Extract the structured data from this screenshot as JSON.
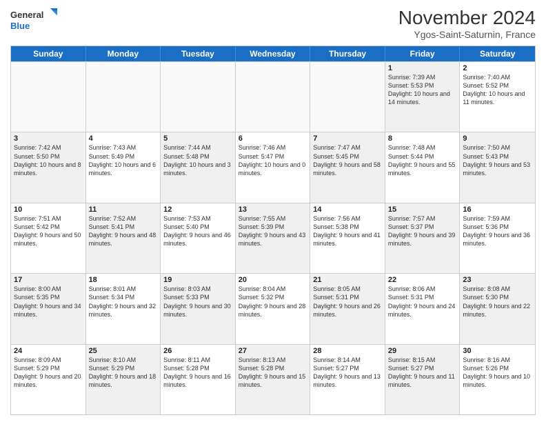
{
  "logo": {
    "line1": "General",
    "line2": "Blue"
  },
  "title": "November 2024",
  "subtitle": "Ygos-Saint-Saturnin, France",
  "header_days": [
    "Sunday",
    "Monday",
    "Tuesday",
    "Wednesday",
    "Thursday",
    "Friday",
    "Saturday"
  ],
  "rows": [
    [
      {
        "day": "",
        "info": "",
        "empty": true
      },
      {
        "day": "",
        "info": "",
        "empty": true
      },
      {
        "day": "",
        "info": "",
        "empty": true
      },
      {
        "day": "",
        "info": "",
        "empty": true
      },
      {
        "day": "",
        "info": "",
        "empty": true
      },
      {
        "day": "1",
        "info": "Sunrise: 7:39 AM\nSunset: 5:53 PM\nDaylight: 10 hours and 14 minutes.",
        "shaded": true
      },
      {
        "day": "2",
        "info": "Sunrise: 7:40 AM\nSunset: 5:52 PM\nDaylight: 10 hours and 11 minutes.",
        "shaded": false
      }
    ],
    [
      {
        "day": "3",
        "info": "Sunrise: 7:42 AM\nSunset: 5:50 PM\nDaylight: 10 hours and 8 minutes.",
        "shaded": true
      },
      {
        "day": "4",
        "info": "Sunrise: 7:43 AM\nSunset: 5:49 PM\nDaylight: 10 hours and 6 minutes.",
        "shaded": false
      },
      {
        "day": "5",
        "info": "Sunrise: 7:44 AM\nSunset: 5:48 PM\nDaylight: 10 hours and 3 minutes.",
        "shaded": true
      },
      {
        "day": "6",
        "info": "Sunrise: 7:46 AM\nSunset: 5:47 PM\nDaylight: 10 hours and 0 minutes.",
        "shaded": false
      },
      {
        "day": "7",
        "info": "Sunrise: 7:47 AM\nSunset: 5:45 PM\nDaylight: 9 hours and 58 minutes.",
        "shaded": true
      },
      {
        "day": "8",
        "info": "Sunrise: 7:48 AM\nSunset: 5:44 PM\nDaylight: 9 hours and 55 minutes.",
        "shaded": false
      },
      {
        "day": "9",
        "info": "Sunrise: 7:50 AM\nSunset: 5:43 PM\nDaylight: 9 hours and 53 minutes.",
        "shaded": true
      }
    ],
    [
      {
        "day": "10",
        "info": "Sunrise: 7:51 AM\nSunset: 5:42 PM\nDaylight: 9 hours and 50 minutes.",
        "shaded": false
      },
      {
        "day": "11",
        "info": "Sunrise: 7:52 AM\nSunset: 5:41 PM\nDaylight: 9 hours and 48 minutes.",
        "shaded": true
      },
      {
        "day": "12",
        "info": "Sunrise: 7:53 AM\nSunset: 5:40 PM\nDaylight: 9 hours and 46 minutes.",
        "shaded": false
      },
      {
        "day": "13",
        "info": "Sunrise: 7:55 AM\nSunset: 5:39 PM\nDaylight: 9 hours and 43 minutes.",
        "shaded": true
      },
      {
        "day": "14",
        "info": "Sunrise: 7:56 AM\nSunset: 5:38 PM\nDaylight: 9 hours and 41 minutes.",
        "shaded": false
      },
      {
        "day": "15",
        "info": "Sunrise: 7:57 AM\nSunset: 5:37 PM\nDaylight: 9 hours and 39 minutes.",
        "shaded": true
      },
      {
        "day": "16",
        "info": "Sunrise: 7:59 AM\nSunset: 5:36 PM\nDaylight: 9 hours and 36 minutes.",
        "shaded": false
      }
    ],
    [
      {
        "day": "17",
        "info": "Sunrise: 8:00 AM\nSunset: 5:35 PM\nDaylight: 9 hours and 34 minutes.",
        "shaded": true
      },
      {
        "day": "18",
        "info": "Sunrise: 8:01 AM\nSunset: 5:34 PM\nDaylight: 9 hours and 32 minutes.",
        "shaded": false
      },
      {
        "day": "19",
        "info": "Sunrise: 8:03 AM\nSunset: 5:33 PM\nDaylight: 9 hours and 30 minutes.",
        "shaded": true
      },
      {
        "day": "20",
        "info": "Sunrise: 8:04 AM\nSunset: 5:32 PM\nDaylight: 9 hours and 28 minutes.",
        "shaded": false
      },
      {
        "day": "21",
        "info": "Sunrise: 8:05 AM\nSunset: 5:31 PM\nDaylight: 9 hours and 26 minutes.",
        "shaded": true
      },
      {
        "day": "22",
        "info": "Sunrise: 8:06 AM\nSunset: 5:31 PM\nDaylight: 9 hours and 24 minutes.",
        "shaded": false
      },
      {
        "day": "23",
        "info": "Sunrise: 8:08 AM\nSunset: 5:30 PM\nDaylight: 9 hours and 22 minutes.",
        "shaded": true
      }
    ],
    [
      {
        "day": "24",
        "info": "Sunrise: 8:09 AM\nSunset: 5:29 PM\nDaylight: 9 hours and 20 minutes.",
        "shaded": false
      },
      {
        "day": "25",
        "info": "Sunrise: 8:10 AM\nSunset: 5:29 PM\nDaylight: 9 hours and 18 minutes.",
        "shaded": true
      },
      {
        "day": "26",
        "info": "Sunrise: 8:11 AM\nSunset: 5:28 PM\nDaylight: 9 hours and 16 minutes.",
        "shaded": false
      },
      {
        "day": "27",
        "info": "Sunrise: 8:13 AM\nSunset: 5:28 PM\nDaylight: 9 hours and 15 minutes.",
        "shaded": true
      },
      {
        "day": "28",
        "info": "Sunrise: 8:14 AM\nSunset: 5:27 PM\nDaylight: 9 hours and 13 minutes.",
        "shaded": false
      },
      {
        "day": "29",
        "info": "Sunrise: 8:15 AM\nSunset: 5:27 PM\nDaylight: 9 hours and 11 minutes.",
        "shaded": true
      },
      {
        "day": "30",
        "info": "Sunrise: 8:16 AM\nSunset: 5:26 PM\nDaylight: 9 hours and 10 minutes.",
        "shaded": false
      }
    ]
  ]
}
